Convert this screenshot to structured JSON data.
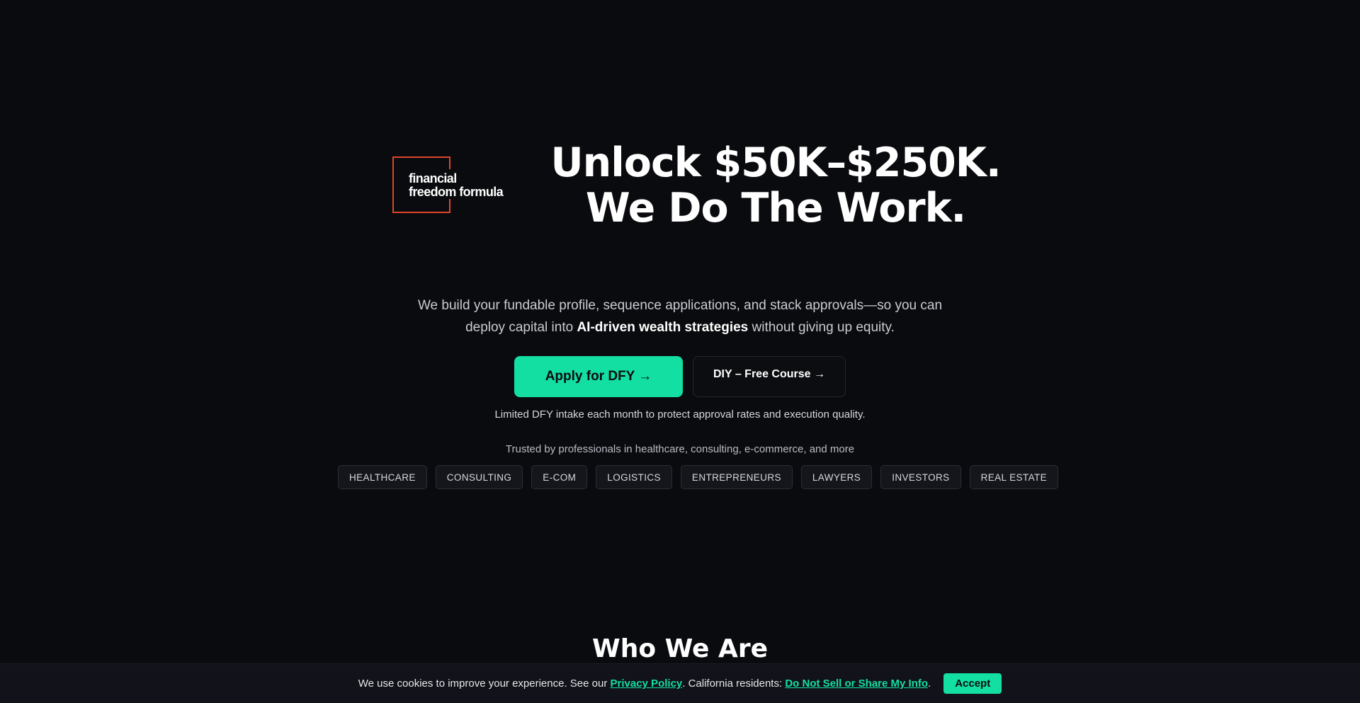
{
  "brand": {
    "logo_line1": "financial",
    "logo_line2": "freedom formula",
    "accent_color": "#e0442d"
  },
  "hero": {
    "headline_line1": "Unlock $50K–$250K.",
    "headline_line2": "We Do The Work.",
    "subtext_part1": "We build your fundable profile, sequence applications, and stack approvals—so you can deploy capital into ",
    "subtext_bold": "AI-driven wealth strategies",
    "subtext_part2": " without giving up equity.",
    "primary_cta": "Apply for DFY →",
    "secondary_cta": "DIY – Free Course →",
    "note": "Limited DFY intake each month to protect approval rates and execution quality.",
    "trusted_text": "Trusted by professionals in healthcare, consulting, e-commerce, and more",
    "tags": [
      "HEALTHCARE",
      "CONSULTING",
      "E-COM",
      "LOGISTICS",
      "ENTREPRENEURS",
      "LAWYERS",
      "INVESTORS",
      "REAL ESTATE"
    ],
    "cta_color": "#13dfa3"
  },
  "about": {
    "heading": "Who We Are"
  },
  "cookie": {
    "text_part1": "We use cookies to improve your experience. See our ",
    "privacy_link": "Privacy Policy",
    "text_part2": ". California residents: ",
    "do_not_sell_link": "Do Not Sell or Share My Info",
    "text_part3": ".",
    "accept_label": "Accept"
  }
}
